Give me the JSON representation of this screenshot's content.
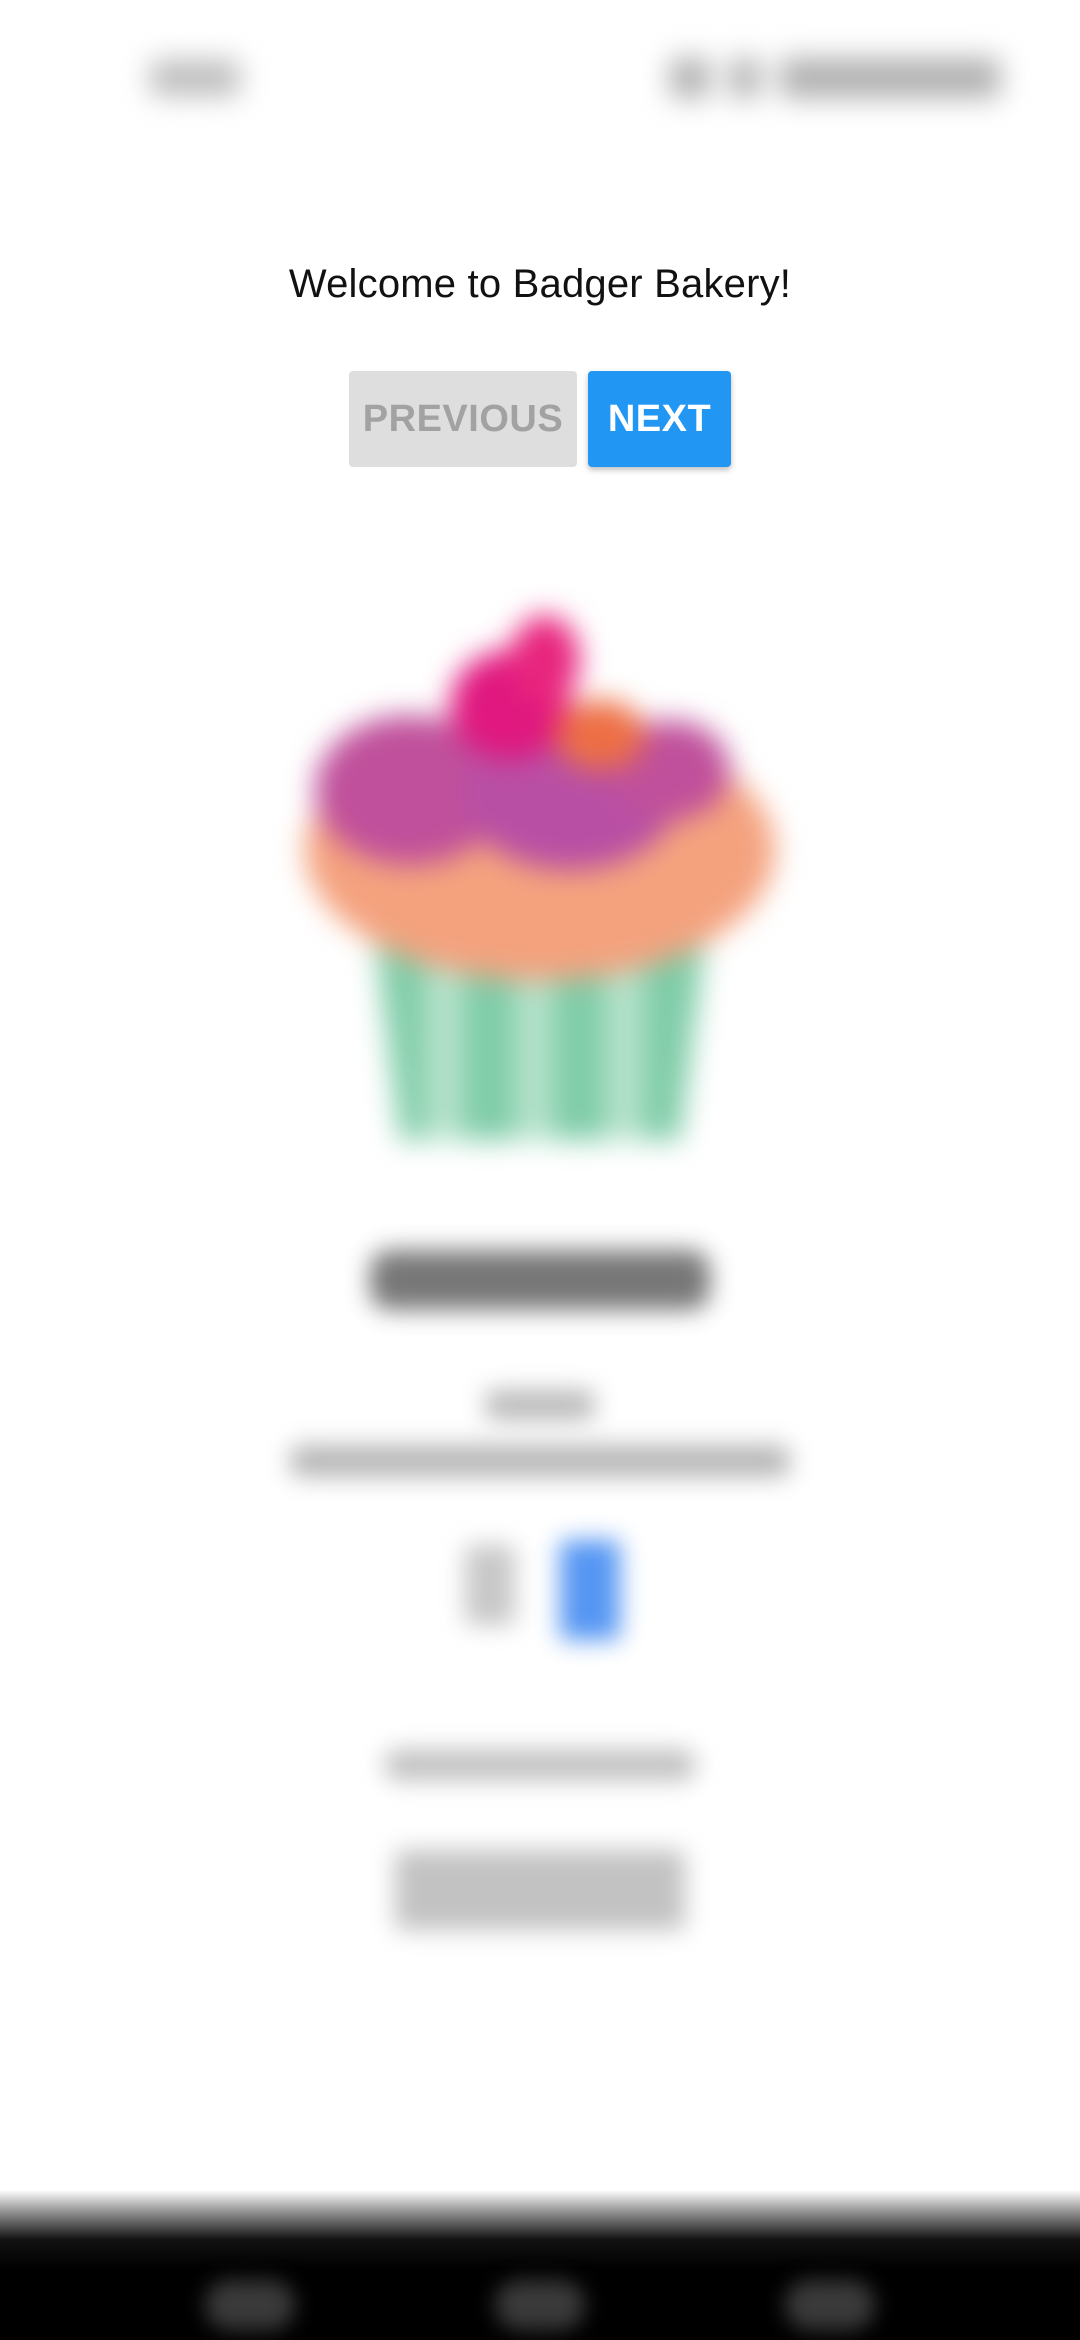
{
  "welcome_text": "Welcome to Badger Bakery!",
  "nav_buttons": {
    "previous_label": "PREVIOUS",
    "next_label": "NEXT"
  },
  "colors": {
    "accent": "#2196f3",
    "disabled_bg": "#dedede",
    "disabled_text": "#a2a2a2"
  },
  "product": {
    "image_icon": "cupcake-icon",
    "blurred": true
  }
}
